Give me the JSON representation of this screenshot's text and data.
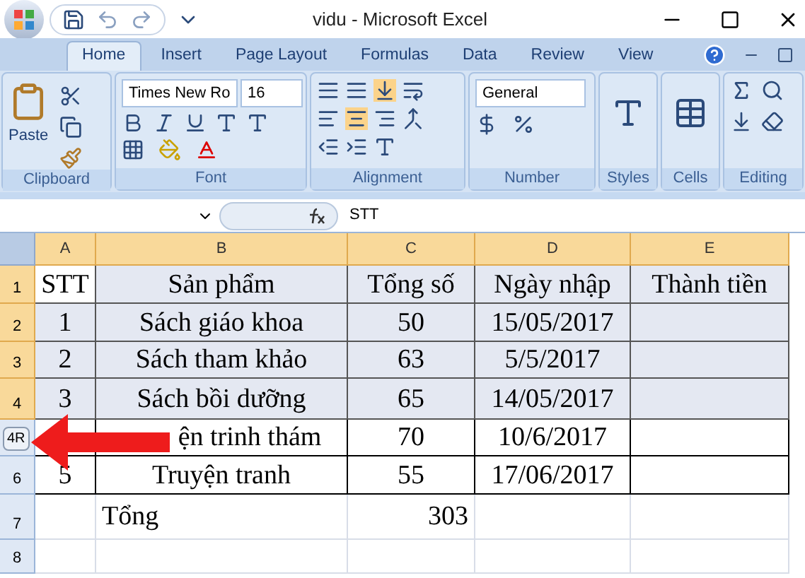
{
  "window": {
    "title": "vidu - Microsoft Excel"
  },
  "tabs": [
    {
      "label": "Home",
      "selected": true
    },
    {
      "label": "Insert",
      "selected": false
    },
    {
      "label": "Page Layout",
      "selected": false
    },
    {
      "label": "Formulas",
      "selected": false
    },
    {
      "label": "Data",
      "selected": false
    },
    {
      "label": "Review",
      "selected": false
    },
    {
      "label": "View",
      "selected": false
    }
  ],
  "ribbon": {
    "clipboard": {
      "label": "Clipboard",
      "paste": "Paste"
    },
    "font": {
      "label": "Font",
      "font_name": "Times New Ro",
      "font_size": "16"
    },
    "alignment": {
      "label": "Alignment"
    },
    "number": {
      "label": "Number",
      "format": "General"
    },
    "styles": {
      "label": "Styles"
    },
    "cells": {
      "label": "Cells"
    },
    "editing": {
      "label": "Editing"
    }
  },
  "formula_bar": {
    "value": "STT"
  },
  "columns": [
    {
      "label": "A",
      "selected": true
    },
    {
      "label": "B",
      "selected": true
    },
    {
      "label": "C",
      "selected": true
    },
    {
      "label": "D",
      "selected": true
    },
    {
      "label": "E",
      "selected": true
    }
  ],
  "rows": [
    {
      "label": "1",
      "selected": true,
      "cells": [
        "STT",
        "Sản phẩm",
        "Tổng số",
        "Ngày nhập",
        "Thành tiền"
      ]
    },
    {
      "label": "2",
      "selected": true,
      "cells": [
        "1",
        "Sách giáo khoa",
        "50",
        "15/05/2017",
        ""
      ]
    },
    {
      "label": "3",
      "selected": true,
      "cells": [
        "2",
        "Sách tham khảo",
        "63",
        "5/5/2017",
        ""
      ]
    },
    {
      "label": "4",
      "selected": true,
      "cells": [
        "3",
        "Sách bồi dưỡng",
        "65",
        "14/05/2017",
        ""
      ]
    },
    {
      "label": "",
      "selected": false,
      "cells": [
        "",
        "ện trinh thám",
        "70",
        "10/6/2017",
        ""
      ]
    },
    {
      "label": "6",
      "selected": false,
      "cells": [
        "5",
        "Truyện tranh",
        "55",
        "17/06/2017",
        ""
      ]
    },
    {
      "label": "7",
      "selected": false,
      "kind": "total",
      "cells": [
        "",
        "Tổng",
        "303",
        "",
        ""
      ]
    },
    {
      "label": "8",
      "selected": false,
      "kind": "blank",
      "cells": [
        "",
        "",
        "",
        "",
        ""
      ]
    }
  ],
  "row_tag": "4R"
}
